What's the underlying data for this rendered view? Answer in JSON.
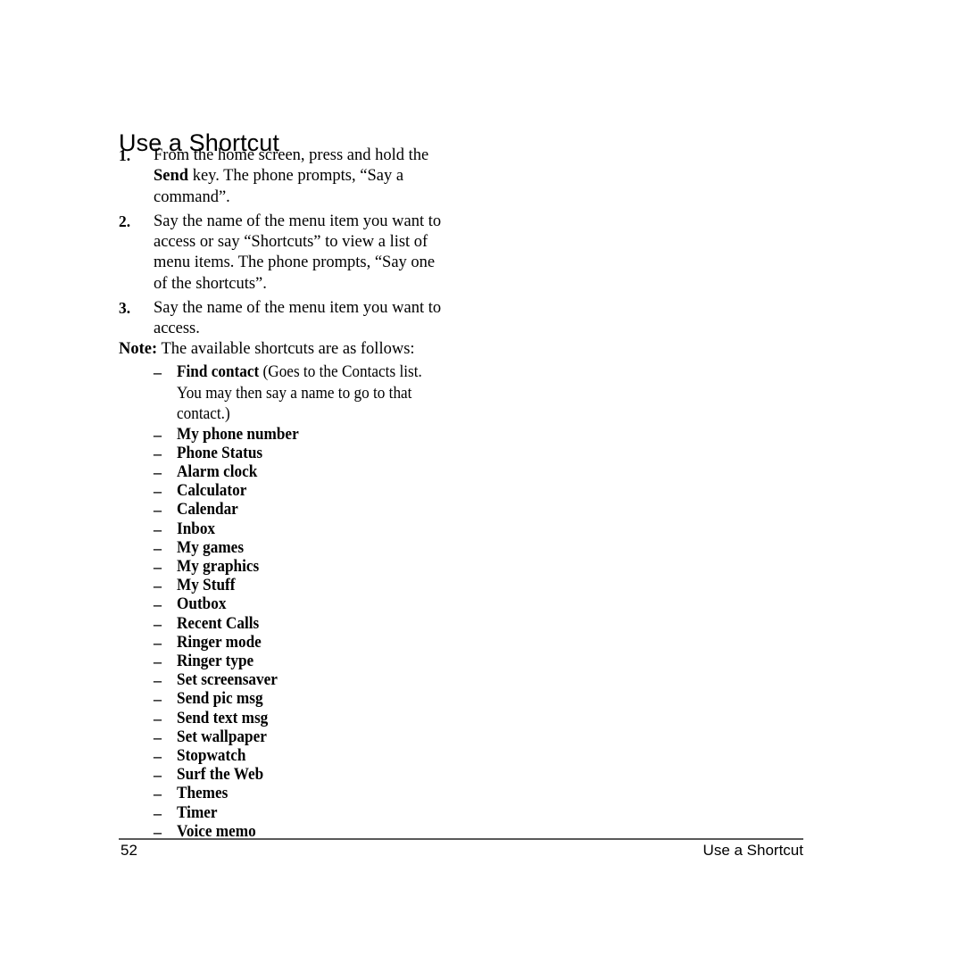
{
  "document": {
    "heading": "Use a Shortcut",
    "steps": [
      {
        "number": "1.",
        "parts": [
          {
            "text": "From the home screen, press and hold the ",
            "bold": false
          },
          {
            "text": "Send",
            "bold": true
          },
          {
            "text": " key. The phone prompts, “Say a command”.",
            "bold": false
          }
        ]
      },
      {
        "number": "2.",
        "parts": [
          {
            "text": "Say the name of the menu item you want to access or say “Shortcuts” to view a list of menu items. The phone prompts, “Say one of the shortcuts”.",
            "bold": false
          }
        ]
      },
      {
        "number": "3.",
        "parts": [
          {
            "text": "Say the name of the menu item you want to access.",
            "bold": false
          }
        ]
      }
    ],
    "note": {
      "label": "Note:",
      "text": " The available shortcuts are as follows:"
    },
    "bullet_dash": "–",
    "bullets": [
      {
        "label": "Find contact",
        "description": " (Goes to the Contacts list. You may then say a name to go to that contact.)"
      },
      {
        "label": "My phone number",
        "description": ""
      },
      {
        "label": "Phone Status",
        "description": ""
      },
      {
        "label": "Alarm clock",
        "description": ""
      },
      {
        "label": "Calculator",
        "description": ""
      },
      {
        "label": "Calendar",
        "description": ""
      },
      {
        "label": "Inbox",
        "description": ""
      },
      {
        "label": "My games",
        "description": ""
      },
      {
        "label": "My graphics",
        "description": ""
      },
      {
        "label": "My Stuff",
        "description": ""
      },
      {
        "label": "Outbox",
        "description": ""
      },
      {
        "label": "Recent Calls",
        "description": ""
      },
      {
        "label": "Ringer mode",
        "description": ""
      },
      {
        "label": "Ringer type",
        "description": ""
      },
      {
        "label": "Set screensaver",
        "description": ""
      },
      {
        "label": "Send pic msg",
        "description": ""
      },
      {
        "label": "Send text msg",
        "description": ""
      },
      {
        "label": "Set wallpaper",
        "description": ""
      },
      {
        "label": "Stopwatch",
        "description": ""
      },
      {
        "label": "Surf the Web",
        "description": ""
      },
      {
        "label": "Themes",
        "description": ""
      },
      {
        "label": "Timer",
        "description": ""
      },
      {
        "label": "Voice memo",
        "description": ""
      }
    ],
    "footer": {
      "page_number": "52",
      "running_title": "Use a Shortcut",
      "rule_color": "#595959"
    }
  }
}
